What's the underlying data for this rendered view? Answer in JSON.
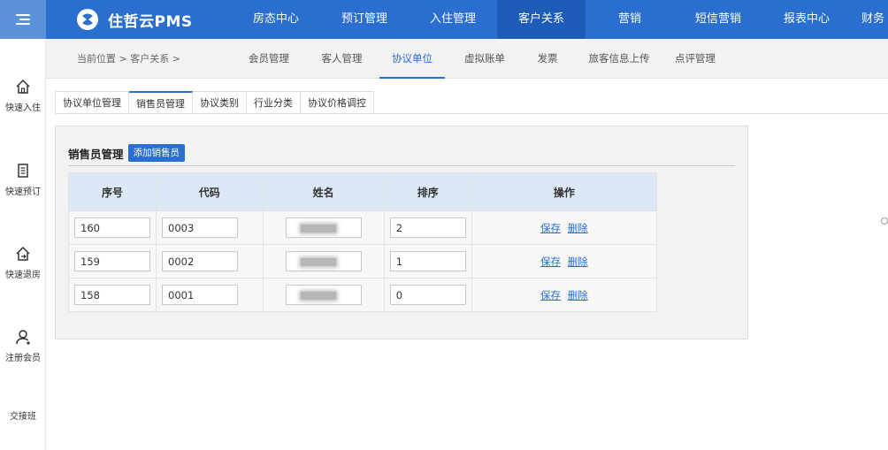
{
  "app": {
    "logo_text": "住哲云PMS"
  },
  "nav": [
    {
      "label": "房态中心",
      "active": false
    },
    {
      "label": "预订管理",
      "active": false
    },
    {
      "label": "入住管理",
      "active": false
    },
    {
      "label": "客户关系",
      "active": true
    },
    {
      "label": "营销",
      "active": false
    },
    {
      "label": "短信营销",
      "active": false
    },
    {
      "label": "报表中心",
      "active": false
    },
    {
      "label": "财务",
      "active": false
    }
  ],
  "sidebar": [
    {
      "label": "快速入住",
      "icon": "home-icon"
    },
    {
      "label": "快速预订",
      "icon": "document-icon"
    },
    {
      "label": "快速退房",
      "icon": "checkout-icon"
    },
    {
      "label": "注册会员",
      "icon": "add-user-icon"
    },
    {
      "label": "交接班",
      "icon": ""
    }
  ],
  "breadcrumb": "当前位置 > 客户关系 >",
  "subnav": [
    {
      "label": "会员管理",
      "active": false
    },
    {
      "label": "客人管理",
      "active": false
    },
    {
      "label": "协议单位",
      "active": true
    },
    {
      "label": "虚拟账单",
      "active": false
    },
    {
      "label": "发票",
      "active": false
    },
    {
      "label": "旅客信息上传",
      "active": false
    },
    {
      "label": "点评管理",
      "active": false
    }
  ],
  "tabs": [
    {
      "label": "协议单位管理",
      "active": false
    },
    {
      "label": "销售员管理",
      "active": true
    },
    {
      "label": "协议类别",
      "active": false
    },
    {
      "label": "行业分类",
      "active": false
    },
    {
      "label": "协议价格调控",
      "active": false
    }
  ],
  "panel": {
    "title": "销售员管理",
    "add_button": "添加销售员",
    "columns": [
      "序号",
      "代码",
      "姓名",
      "排序",
      "操作"
    ],
    "rows": [
      {
        "id": "160",
        "code": "0003",
        "sort": "2"
      },
      {
        "id": "159",
        "code": "0002",
        "sort": "1"
      },
      {
        "id": "158",
        "code": "0001",
        "sort": "0"
      }
    ],
    "save_label": "保存",
    "delete_label": "删除"
  },
  "colors": {
    "brand": "#2a6ecf",
    "nav_active": "#1d5db7",
    "header_row": "#dde8f6"
  }
}
